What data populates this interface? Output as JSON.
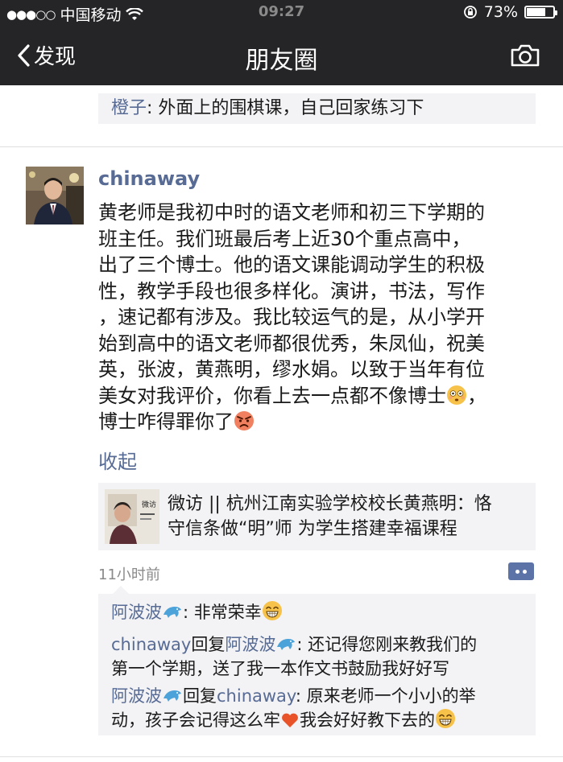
{
  "status_bar": {
    "carrier": "中国移动",
    "time": "09:27",
    "battery": "73%",
    "battery_level": 0.73
  },
  "nav": {
    "back_label": "发现",
    "title": "朋友圈"
  },
  "previous_comment": {
    "author": "橙子",
    "sep": ": ",
    "text": "外面上的围棋课，自己回家练习下"
  },
  "post": {
    "username": "chinaway",
    "content_lines": [
      "黄老师是我初中时的语文老师和初三下学期的",
      "班主任。我们班最后考上近30个重点高中，",
      "出了三个博士。他的语文课能调动学生的积极",
      "性，教学手段也很多样化。演讲，书法，写作",
      "，速记都有涉及。我比较运气的是，从小学开",
      "始到高中的语文老师都很优秀，朱凤仙，祝美",
      "英，张波，黄燕明，缪水娟。以致于当年有位",
      "美女对我评价，你看上去一点都不像博士",
      "，",
      "博士咋得罪你了"
    ],
    "collapse_label": "收起",
    "article": {
      "title_line1": "微访 || 杭州江南实验学校校长黄燕明：恪",
      "title_line2": "守信条做“明”师 为学生搭建幸福课程",
      "thumb_text": "微访"
    },
    "timestamp": "11小时前"
  },
  "comments": [
    {
      "author": "阿波波",
      "reply_word": "",
      "reply_to": "",
      "sep": ": ",
      "text": "非常荣幸"
    },
    {
      "author": "chinaway",
      "reply_word": "回复",
      "reply_to": "阿波波",
      "sep": ": ",
      "text1": "还记得您刚来教我们的",
      "text2": "第一个学期，送了我一本作文书鼓励我好好写"
    },
    {
      "author": "阿波波",
      "reply_word": "回复",
      "reply_to": "chinaway",
      "sep": ": ",
      "text1": "原来老师一个小小的举",
      "text2a": "动，孩子会记得这么牢",
      "text2b": "我会好好教下去的"
    }
  ],
  "colors": {
    "navbar": "#252527",
    "link": "#576b95",
    "comment_bg": "#f3f3f5"
  },
  "icons": [
    "back-chevron-icon",
    "wifi-icon",
    "camera-icon",
    "lock-rotation-icon",
    "more-icon",
    "dolphin-emoji",
    "grin-emoji",
    "heart-emoji",
    "flushed-emoji",
    "angry-emoji"
  ]
}
